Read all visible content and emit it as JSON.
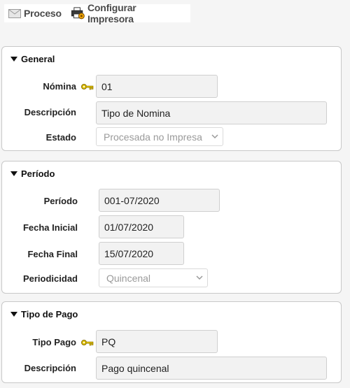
{
  "toolbar": {
    "proceso_label": "Proceso",
    "configurar_label": "Configurar Impresora"
  },
  "general": {
    "title": "General",
    "nomina_label": "Nómina",
    "nomina_value": "01",
    "descripcion_label": "Descripción",
    "descripcion_value": "Tipo de Nomina",
    "estado_label": "Estado",
    "estado_value": "Procesada no Impresa"
  },
  "periodo": {
    "title": "Período",
    "periodo_label": "Período",
    "periodo_value": "001-07/2020",
    "fecha_inicial_label": "Fecha Inicial",
    "fecha_inicial_value": "01/07/2020",
    "fecha_final_label": "Fecha Final",
    "fecha_final_value": "15/07/2020",
    "periodicidad_label": "Periodicidad",
    "periodicidad_value": "Quincenal"
  },
  "tipo_pago": {
    "title": "Tipo de Pago",
    "tipo_pago_label": "Tipo Pago",
    "tipo_pago_value": "PQ",
    "descripcion_label": "Descripción",
    "descripcion_value": "Pago quincenal"
  },
  "icons": {
    "proceso": "envelope-icon",
    "configurar": "printer-icon",
    "key": "key-icon",
    "expand": "triangle-down-icon",
    "dropdown": "chevron-down-icon"
  }
}
